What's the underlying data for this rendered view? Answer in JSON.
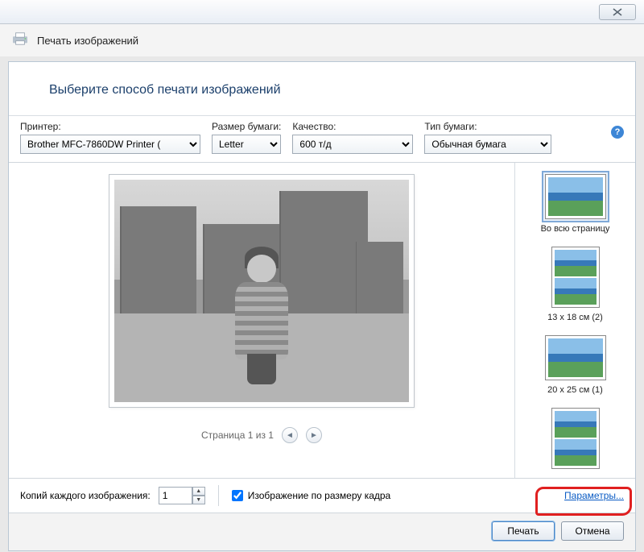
{
  "window": {
    "title": "Печать изображений",
    "close_x": "X"
  },
  "prompt": "Выберите способ печати изображений",
  "labels": {
    "printer": "Принтер:",
    "paper_size": "Размер бумаги:",
    "quality": "Качество:",
    "paper_type": "Тип бумаги:"
  },
  "dropdown": {
    "printer": "Brother MFC-7860DW Printer ( ",
    "paper_size": "Letter",
    "quality": "600 т/д",
    "paper_type": "Обычная бумага"
  },
  "help": "?",
  "pager": {
    "text": "Страница 1 из 1",
    "prev": "◄",
    "next": "►"
  },
  "layouts": {
    "full": "Во всю страницу",
    "l13x18": "13 x 18 см (2)",
    "l20x25": "20 x 25 см (1)"
  },
  "footer": {
    "copies_label": "Копий каждого изображения:",
    "copies_value": "1",
    "fit_label": "Изображение по размеру кадра",
    "fit_checked": true,
    "options_link": "Параметры...",
    "spin_up": "▲",
    "spin_down": "▼"
  },
  "buttons": {
    "print": "Печать",
    "cancel": "Отмена"
  }
}
